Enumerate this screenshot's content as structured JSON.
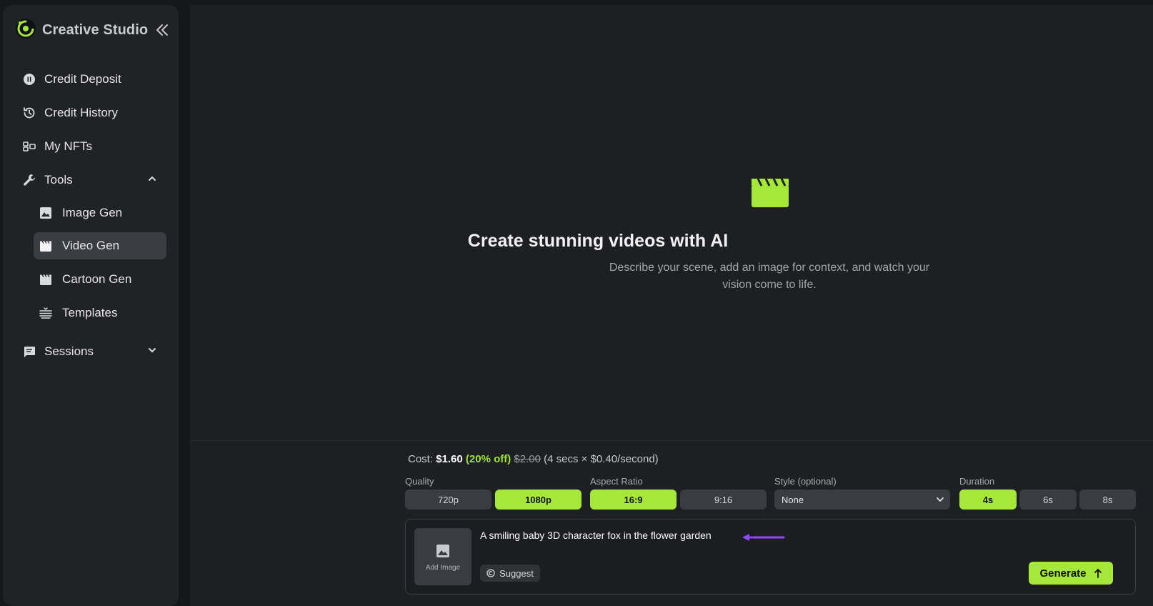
{
  "app": {
    "title": "Creative Studio"
  },
  "sidebar": {
    "items": [
      {
        "label": "Credit Deposit",
        "icon": "coin-icon"
      },
      {
        "label": "Credit History",
        "icon": "history-icon"
      },
      {
        "label": "My NFTs",
        "icon": "nft-grid-icon"
      },
      {
        "label": "Tools",
        "icon": "wrench-icon",
        "expanded": true
      },
      {
        "label": "Sessions",
        "icon": "chat-icon",
        "expanded": false
      }
    ],
    "tools": [
      {
        "label": "Image Gen",
        "icon": "image-icon"
      },
      {
        "label": "Video Gen",
        "icon": "clapperboard-icon",
        "active": true
      },
      {
        "label": "Cartoon Gen",
        "icon": "clapperboard-icon"
      },
      {
        "label": "Templates",
        "icon": "templates-icon"
      }
    ]
  },
  "hero": {
    "title": "Create stunning videos with AI",
    "subtitle": "Describe your scene, add an image for context, and watch your vision come to life."
  },
  "cost": {
    "prefix": "Cost:",
    "price": "$1.60",
    "discount": "(20% off)",
    "original": "$2.00",
    "detail": "(4 secs × $0.40/second)"
  },
  "controls": {
    "quality": {
      "label": "Quality",
      "options": [
        "720p",
        "1080p"
      ],
      "selected": "1080p"
    },
    "aspect": {
      "label": "Aspect Ratio",
      "options": [
        "16:9",
        "9:16"
      ],
      "selected": "16:9"
    },
    "style": {
      "label": "Style (optional)",
      "value": "None"
    },
    "duration": {
      "label": "Duration",
      "options": [
        "4s",
        "6s",
        "8s"
      ],
      "selected": "4s"
    }
  },
  "prompt": {
    "add_image_label": "Add Image",
    "text": "A smiling baby 3D character fox in the flower garden",
    "suggest_label": "Suggest",
    "generate_label": "Generate"
  },
  "colors": {
    "accent": "#a6e83a",
    "annotation_arrow": "#8b4cf0",
    "background": "#1e1f22",
    "sidebar": "#212225"
  }
}
